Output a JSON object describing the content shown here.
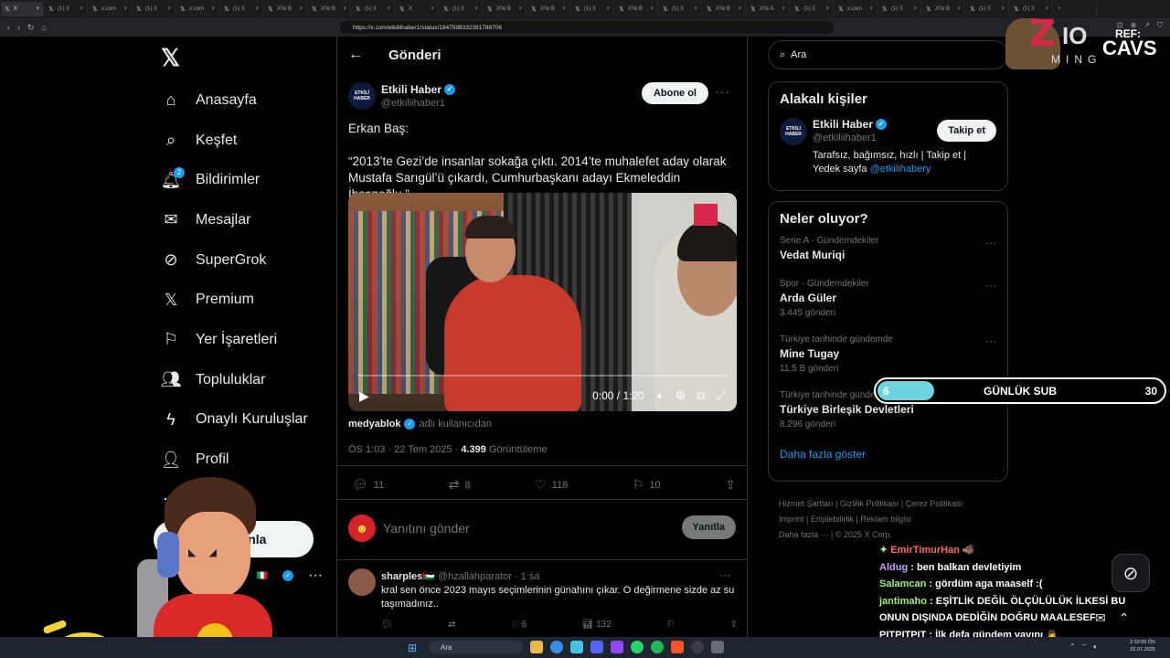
{
  "browser": {
    "tabs": [
      {
        "label": "X"
      },
      {
        "label": "(1) X"
      },
      {
        "label": "x.com"
      },
      {
        "label": "(1) X"
      },
      {
        "label": "x.com"
      },
      {
        "label": "(1) X"
      },
      {
        "label": "X'te B"
      },
      {
        "label": "X'te B"
      },
      {
        "label": "(1) X"
      },
      {
        "label": "X"
      },
      {
        "label": "(1) X"
      },
      {
        "label": "X'te B"
      },
      {
        "label": "X'te B"
      },
      {
        "label": "(1) X"
      },
      {
        "label": "X'te B"
      },
      {
        "label": "(1) X"
      },
      {
        "label": "X'te B"
      },
      {
        "label": "X'te A"
      },
      {
        "label": "(1) X"
      },
      {
        "label": "x.com"
      },
      {
        "label": "(1) X"
      },
      {
        "label": "X'te B"
      },
      {
        "label": "(1) X"
      },
      {
        "label": "(1) X"
      }
    ],
    "url": "https://x.com/etkiliihaber1/status/1947598332391788706"
  },
  "nav": {
    "logo": "𝕏",
    "items": [
      {
        "label": "Anasayfa",
        "icon": "home-icon"
      },
      {
        "label": "Keşfet",
        "icon": "search-icon"
      },
      {
        "label": "Bildirimler",
        "icon": "bell-icon",
        "badge": "2"
      },
      {
        "label": "Mesajlar",
        "icon": "mail-icon"
      },
      {
        "label": "SuperGrok",
        "icon": "grok-icon"
      },
      {
        "label": "Premium",
        "icon": "x-premium-icon"
      },
      {
        "label": "Yer İşaretleri",
        "icon": "bookmark-icon"
      },
      {
        "label": "Topluluklar",
        "icon": "communities-icon"
      },
      {
        "label": "Onaylı Kuruluşlar",
        "icon": "lightning-icon"
      },
      {
        "label": "Profil",
        "icon": "profile-icon"
      },
      {
        "label": "a",
        "icon": "more-icon"
      }
    ],
    "post_button": "yınla",
    "account_name": "li",
    "account_flag": "🇮🇹"
  },
  "post": {
    "header_title": "Gönderi",
    "author_name": "Etkili Haber",
    "author_handle": "@etkiliihaber1",
    "avatar_text": "ETKİLİ HABER",
    "subscribe_label": "Abone ol",
    "text_line1": "Erkan Baş:",
    "text_line2": "“2013’te Gezi’de insanlar sokağa çıktı. 2014’te muhalefet aday olarak Mustafa Sarıgül’ü çıkardı, Cumhurbaşkanı adayı Ekmeleddin İhsanoğlu.”",
    "video_time": "0:00 / 1:20",
    "video_progress": 0,
    "source_name": "medyablok",
    "source_suffix": "adlı kullanıcıdan",
    "timestamp": "ÖS 1:03 · 22 Tem 2025 · ",
    "views": "4.399",
    "views_label": " Görüntüleme",
    "replies": "11",
    "reposts": "8",
    "likes": "118",
    "bookmarks": "10",
    "reply_placeholder": "Yanıtını gönder",
    "reply_button": "Yanıtla"
  },
  "comment": {
    "name": "sharples",
    "flag": "🇵🇸",
    "handle": "@hzallahparator",
    "time": " · 1 sa",
    "text": "kral sen önce 2023 mayıs seçimlerinin günahını çıkar. O değirmene sizde az su taşımadınız..",
    "likes": "6",
    "views": "132"
  },
  "sidebar": {
    "search_placeholder": "Ara",
    "relevant_title": "Alakalı kişiler",
    "rel_name": "Etkili Haber",
    "rel_handle": "@etkiliihaber1",
    "rel_bio": "Tarafsız, bağımsız, hızlı | Takip et | Yedek sayfa ",
    "rel_bio_link": "@etkilihabery",
    "follow_label": "Takip et",
    "trends_title": "Neler oluyor?",
    "trends": [
      {
        "category": "Serie A · Gündemdekiler",
        "name": "Vedat Muriqi",
        "count": ""
      },
      {
        "category": "Spor · Gündemdekiler",
        "name": "Arda Güler",
        "count": "3.445 gönderi"
      },
      {
        "category": "Türkiye tarihinde gündemde",
        "name": "Mine Tugay",
        "count": "11,5 B gönderi"
      },
      {
        "category": "Türkiye tarihinde gündemde",
        "name": "Türkiye Birleşik Devletleri",
        "count": "8.296 gönderi"
      }
    ],
    "show_more": "Daha fazla göster",
    "footer": [
      "Hizmet Şartları",
      "Gizlilik Politikası",
      "Çerez Politikası",
      "Imprint",
      "Erişilebilirlik",
      "Reklam bilgisi",
      "Daha fazla ···",
      "© 2025 X Corp."
    ]
  },
  "overlay": {
    "brand_z": "Z",
    "brand_io": "IO",
    "brand_ming": "MING",
    "brand_ref": "REF:",
    "brand_cavs": "CAVS",
    "sub_current": "6",
    "sub_label": "GÜNLÜK SUB",
    "sub_max": "30",
    "sub_progress": 0.2,
    "chat": [
      {
        "user": "EmirTimurHan",
        "prefix": "✦ ",
        "msg": " 🐗",
        "color": "red"
      },
      {
        "user": "Aldug",
        "prefix": "",
        "msg": " : ben balkan devletiyim",
        "color": "purple"
      },
      {
        "user": "Salamcan",
        "prefix": "",
        "msg": " : gördüm aga maaself :(",
        "color": "green"
      },
      {
        "user": "jantimaho",
        "prefix": "",
        "msg": " : EŞİTLİK DEĞİL ÖLÇÜLÜLÜK İLKESİ BU ONUN DIŞINDA DEDİĞİN DOĞRU MAALESEF",
        "color": "green"
      },
      {
        "user": "PITPITPIT",
        "prefix": "",
        "msg": " : İlk defa gündem yayını 🙇",
        "color": "white"
      }
    ]
  },
  "taskbar": {
    "search": "Ara",
    "time": "2:32:09 ÖS",
    "date": "22.07.2025"
  }
}
